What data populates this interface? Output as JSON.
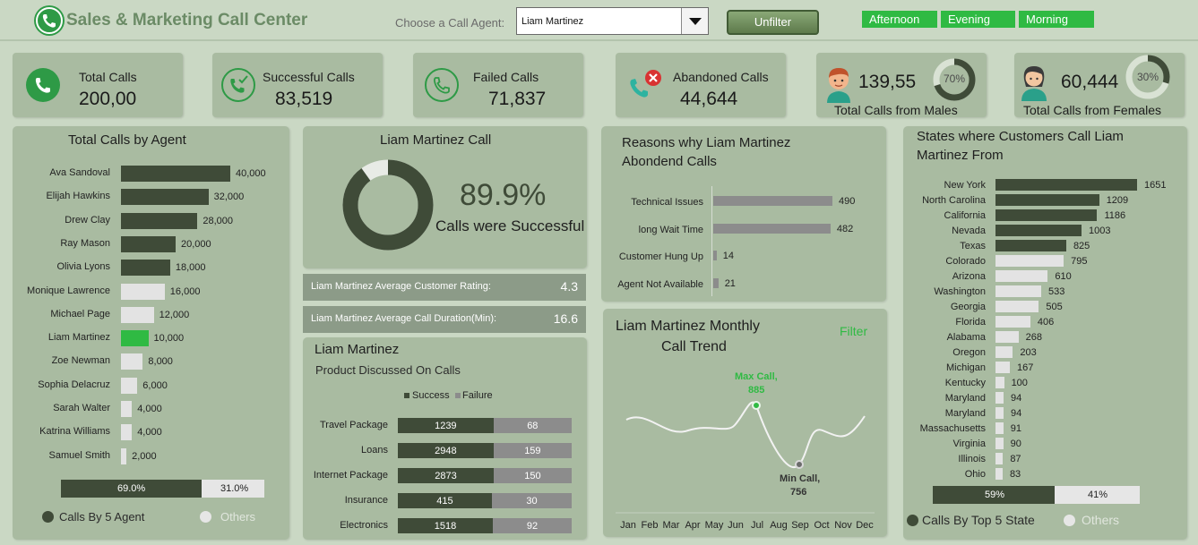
{
  "header": {
    "title": "Sales & Marketing Call Center",
    "agent_label": "Choose a Call Agent:",
    "agent_selected": "Liam Martinez",
    "unfilter_label": "Unfilter",
    "slicers": [
      "Afternoon",
      "Evening",
      "Morning"
    ]
  },
  "kpis": {
    "total_calls": {
      "label": "Total Calls",
      "value": "200,00"
    },
    "successful_calls": {
      "label": "Successful Calls",
      "value": "83,519"
    },
    "failed_calls": {
      "label": "Failed Calls",
      "value": "71,837"
    },
    "abandoned_calls": {
      "label": "Abandoned Calls",
      "value": "44,644"
    },
    "males": {
      "label": "Total Calls from Males",
      "value": "139,55",
      "pct": "70%",
      "fraction": 0.7
    },
    "females": {
      "label": "Total Calls from Females",
      "value": "60,444",
      "pct": "30%",
      "fraction": 0.3
    }
  },
  "agents_chart": {
    "title": "Total Calls by Agent",
    "max": 40000,
    "items": [
      {
        "name": "Ava Sandoval",
        "value": 40000,
        "label": "40,000",
        "top5": true
      },
      {
        "name": "Elijah Hawkins",
        "value": 32000,
        "label": "32,000",
        "top5": true
      },
      {
        "name": "Drew Clay",
        "value": 28000,
        "label": "28,000",
        "top5": true
      },
      {
        "name": "Ray Mason",
        "value": 20000,
        "label": "20,000",
        "top5": true
      },
      {
        "name": "Olivia Lyons",
        "value": 18000,
        "label": "18,000",
        "top5": true
      },
      {
        "name": "Monique Lawrence",
        "value": 16000,
        "label": "16,000",
        "top5": false
      },
      {
        "name": "Michael Page",
        "value": 12000,
        "label": "12,000",
        "top5": false
      },
      {
        "name": "Liam Martinez",
        "value": 10000,
        "label": "10,000",
        "top5": false,
        "selected": true
      },
      {
        "name": "Zoe Newman",
        "value": 8000,
        "label": "8,000",
        "top5": false
      },
      {
        "name": "Sophia Delacruz",
        "value": 6000,
        "label": "6,000",
        "top5": false
      },
      {
        "name": "Sarah Walter",
        "value": 4000,
        "label": "4,000",
        "top5": false
      },
      {
        "name": "Katrina Williams",
        "value": 4000,
        "label": "4,000",
        "top5": false
      },
      {
        "name": "Samuel Smith",
        "value": 2000,
        "label": "2,000",
        "top5": false
      }
    ],
    "split": {
      "top5": 0.69,
      "top5_label": "69.0%",
      "others_label": "31.0%"
    },
    "legend_top5": "Calls By 5 Agent",
    "legend_others": "Others"
  },
  "success_panel": {
    "title": "Liam Martinez Call",
    "pct_label": "89.9%",
    "fraction": 0.899,
    "caption": "Calls were Successful"
  },
  "stats": {
    "rating_label": "Liam Martinez Average Customer Rating:",
    "rating_value": "4.3",
    "duration_label": "Liam Martinez Average Call Duration(Min):",
    "duration_value": "16.6"
  },
  "products": {
    "title": "Liam Martinez",
    "subtitle": "Product Discussed On Calls",
    "legend_success": "Success",
    "legend_failure": "Failure",
    "items": [
      {
        "name": "Travel Package",
        "success": 1239,
        "failure": 68
      },
      {
        "name": "Loans",
        "success": 2948,
        "failure": 159
      },
      {
        "name": "Internet Package",
        "success": 2873,
        "failure": 150
      },
      {
        "name": "Insurance",
        "success": 415,
        "failure": 30
      },
      {
        "name": "Electronics",
        "success": 1518,
        "failure": 92
      }
    ]
  },
  "reasons": {
    "title_line1": "Reasons why Liam Martinez",
    "title_line2": "Abondend Calls",
    "max": 490,
    "items": [
      {
        "name": "Technical Issues",
        "value": 490
      },
      {
        "name": "long Wait Time",
        "value": 482
      },
      {
        "name": "Customer Hung Up",
        "value": 14
      },
      {
        "name": "Agent Not Available",
        "value": 21
      }
    ]
  },
  "trend": {
    "title_line1": "Liam Martinez Monthly",
    "title_line2": "Call Trend",
    "filter_label": "Filter",
    "max_label_1": "Max Call,",
    "max_label_2": "885",
    "min_label_1": "Min Call,",
    "min_label_2": "756",
    "months": [
      "Jan",
      "Feb",
      "Mar",
      "Apr",
      "May",
      "Jun",
      "Jul",
      "Aug",
      "Sep",
      "Oct",
      "Nov",
      "Dec"
    ]
  },
  "states": {
    "title_line1": "States where Customers Call Liam",
    "title_line2": "Martinez From",
    "max": 1651,
    "items": [
      {
        "name": "New York",
        "value": 1651,
        "top5": true
      },
      {
        "name": "North Carolina",
        "value": 1209,
        "top5": true
      },
      {
        "name": "California",
        "value": 1186,
        "top5": true
      },
      {
        "name": "Nevada",
        "value": 1003,
        "top5": true
      },
      {
        "name": "Texas",
        "value": 825,
        "top5": true
      },
      {
        "name": "Colorado",
        "value": 795,
        "top5": false
      },
      {
        "name": "Arizona",
        "value": 610,
        "top5": false
      },
      {
        "name": "Washington",
        "value": 533,
        "top5": false
      },
      {
        "name": "Georgia",
        "value": 505,
        "top5": false
      },
      {
        "name": "Florida",
        "value": 406,
        "top5": false
      },
      {
        "name": "Alabama",
        "value": 268,
        "top5": false
      },
      {
        "name": "Oregon",
        "value": 203,
        "top5": false
      },
      {
        "name": "Michigan",
        "value": 167,
        "top5": false
      },
      {
        "name": "Kentucky",
        "value": 100,
        "top5": false
      },
      {
        "name": "Maryland",
        "value": 94,
        "top5": false
      },
      {
        "name": "Maryland",
        "value": 94,
        "top5": false
      },
      {
        "name": "Massachusetts",
        "value": 91,
        "top5": false
      },
      {
        "name": "Virginia",
        "value": 90,
        "top5": false
      },
      {
        "name": "Illinois",
        "value": 87,
        "top5": false
      },
      {
        "name": "Ohio",
        "value": 83,
        "top5": false
      }
    ],
    "split": {
      "top5": 0.59,
      "top5_label": "59%",
      "others_label": "41%"
    },
    "legend_top5": "Calls By Top 5 State",
    "legend_others": "Others"
  },
  "colors": {
    "dark": "#3f4b38",
    "light": "#e3e3e3",
    "accent": "#2fba43",
    "gray": "#8c8c8c"
  }
}
